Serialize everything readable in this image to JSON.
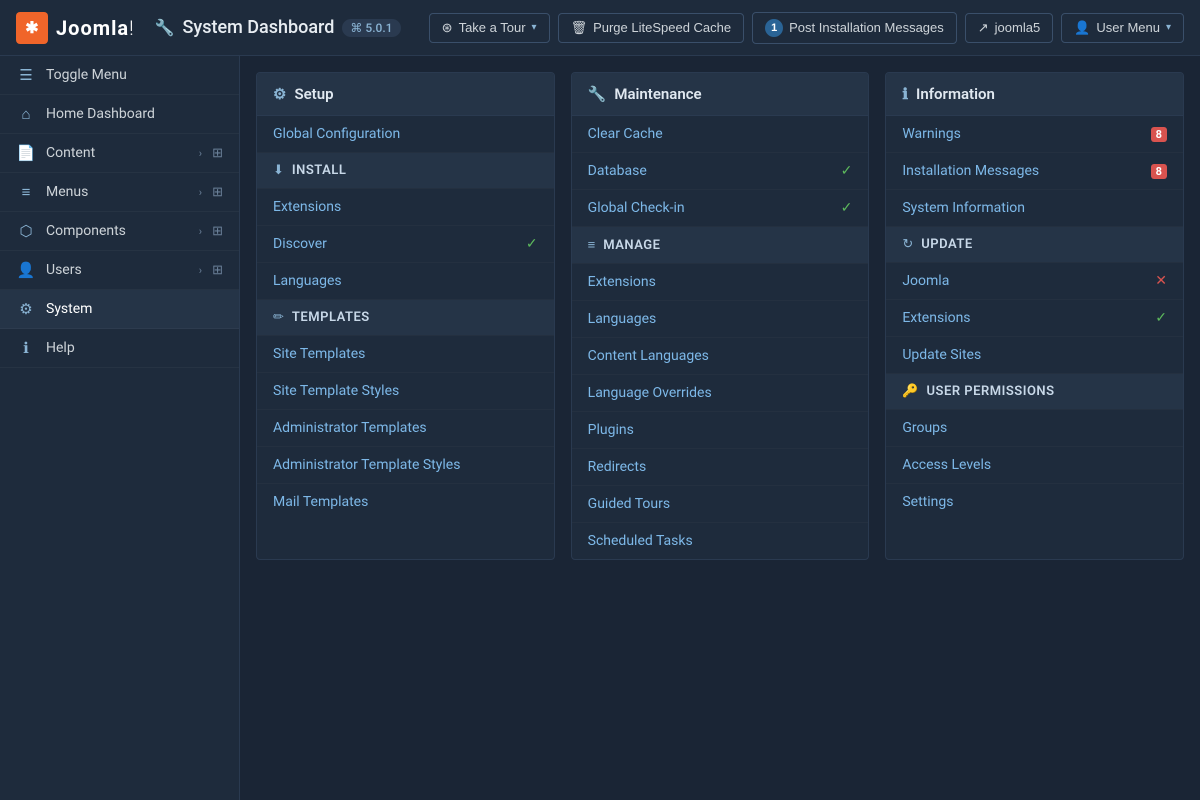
{
  "topbar": {
    "logo_symbol": "✱",
    "logo_name_prefix": "Joomla",
    "logo_name_suffix": "!",
    "page_title": "System Dashboard",
    "page_title_icon": "🔧",
    "version": "⌘ 5.0.1",
    "buttons": [
      {
        "id": "take-tour",
        "icon": "⊛",
        "label": "Take a Tour",
        "has_chevron": true
      },
      {
        "id": "purge-cache",
        "icon": "🗑",
        "label": "Purge LiteSpeed Cache",
        "has_chevron": false
      },
      {
        "id": "post-install",
        "icon": "🔔",
        "badge": "1",
        "label": "Post Installation Messages",
        "has_chevron": false
      },
      {
        "id": "joomla5-link",
        "icon": "↗",
        "label": "joomla5",
        "has_chevron": false
      },
      {
        "id": "user-menu",
        "icon": "👤",
        "label": "User Menu",
        "has_chevron": true
      }
    ]
  },
  "sidebar": {
    "items": [
      {
        "id": "toggle-menu",
        "icon": "☰",
        "label": "Toggle Menu",
        "has_arrow": false,
        "has_grid": false
      },
      {
        "id": "home-dashboard",
        "icon": "⌂",
        "label": "Home Dashboard",
        "has_arrow": false,
        "has_grid": false
      },
      {
        "id": "content",
        "icon": "📄",
        "label": "Content",
        "has_arrow": true,
        "has_grid": true
      },
      {
        "id": "menus",
        "icon": "≡",
        "label": "Menus",
        "has_arrow": true,
        "has_grid": true
      },
      {
        "id": "components",
        "icon": "⬡",
        "label": "Components",
        "has_arrow": true,
        "has_grid": true
      },
      {
        "id": "users",
        "icon": "👤",
        "label": "Users",
        "has_arrow": true,
        "has_grid": true
      },
      {
        "id": "system",
        "icon": "⚙",
        "label": "System",
        "has_arrow": false,
        "has_grid": false,
        "active": true
      },
      {
        "id": "help",
        "icon": "ℹ",
        "label": "Help",
        "has_arrow": false,
        "has_grid": false
      }
    ]
  },
  "cards": {
    "setup": {
      "header_icon": "⚙",
      "header_label": "Setup",
      "items": [
        {
          "id": "global-config",
          "label": "Global Configuration",
          "status": null
        }
      ],
      "sections": [
        {
          "id": "install",
          "icon": "⬇",
          "label": "Install",
          "items": [
            {
              "id": "extensions-install",
              "label": "Extensions",
              "status": null
            },
            {
              "id": "discover",
              "label": "Discover",
              "status": "check"
            },
            {
              "id": "languages",
              "label": "Languages",
              "status": null
            }
          ]
        },
        {
          "id": "templates",
          "icon": "✏",
          "label": "Templates",
          "items": [
            {
              "id": "site-templates",
              "label": "Site Templates",
              "status": null
            },
            {
              "id": "site-template-styles",
              "label": "Site Template Styles",
              "status": null
            },
            {
              "id": "admin-templates",
              "label": "Administrator Templates",
              "status": null
            },
            {
              "id": "admin-template-styles",
              "label": "Administrator Template Styles",
              "status": null
            },
            {
              "id": "mail-templates",
              "label": "Mail Templates",
              "status": null
            }
          ]
        }
      ]
    },
    "maintenance": {
      "header_icon": "🔧",
      "header_label": "Maintenance",
      "items": [
        {
          "id": "clear-cache",
          "label": "Clear Cache",
          "status": null
        },
        {
          "id": "database",
          "label": "Database",
          "status": "check"
        },
        {
          "id": "global-checkin",
          "label": "Global Check-in",
          "status": "check"
        }
      ],
      "sections": [
        {
          "id": "manage",
          "icon": "≡",
          "label": "Manage",
          "items": [
            {
              "id": "extensions-manage",
              "label": "Extensions",
              "status": null
            },
            {
              "id": "languages-manage",
              "label": "Languages",
              "status": null
            },
            {
              "id": "content-languages",
              "label": "Content Languages",
              "status": null
            },
            {
              "id": "language-overrides",
              "label": "Language Overrides",
              "status": null
            },
            {
              "id": "plugins",
              "label": "Plugins",
              "status": null
            },
            {
              "id": "redirects",
              "label": "Redirects",
              "status": null
            },
            {
              "id": "guided-tours",
              "label": "Guided Tours",
              "status": null
            },
            {
              "id": "scheduled-tasks",
              "label": "Scheduled Tasks",
              "status": null
            }
          ]
        }
      ]
    },
    "information": {
      "header_icon": "ℹ",
      "header_label": "Information",
      "items": [
        {
          "id": "warnings",
          "label": "Warnings",
          "status": "badge-red",
          "badge_value": "8"
        },
        {
          "id": "installation-messages",
          "label": "Installation Messages",
          "status": "badge-red",
          "badge_value": "8"
        },
        {
          "id": "system-information",
          "label": "System Information",
          "status": null
        }
      ],
      "sections": [
        {
          "id": "update",
          "icon": "↻",
          "label": "Update",
          "items": [
            {
              "id": "joomla-update",
              "label": "Joomla",
              "status": "cross"
            },
            {
              "id": "extensions-update",
              "label": "Extensions",
              "status": "check"
            },
            {
              "id": "update-sites",
              "label": "Update Sites",
              "status": null
            }
          ]
        },
        {
          "id": "user-permissions",
          "icon": "🔑",
          "label": "User Permissions",
          "items": [
            {
              "id": "groups",
              "label": "Groups",
              "status": null
            },
            {
              "id": "access-levels",
              "label": "Access Levels",
              "status": null
            },
            {
              "id": "settings",
              "label": "Settings",
              "status": null
            }
          ]
        }
      ]
    }
  }
}
